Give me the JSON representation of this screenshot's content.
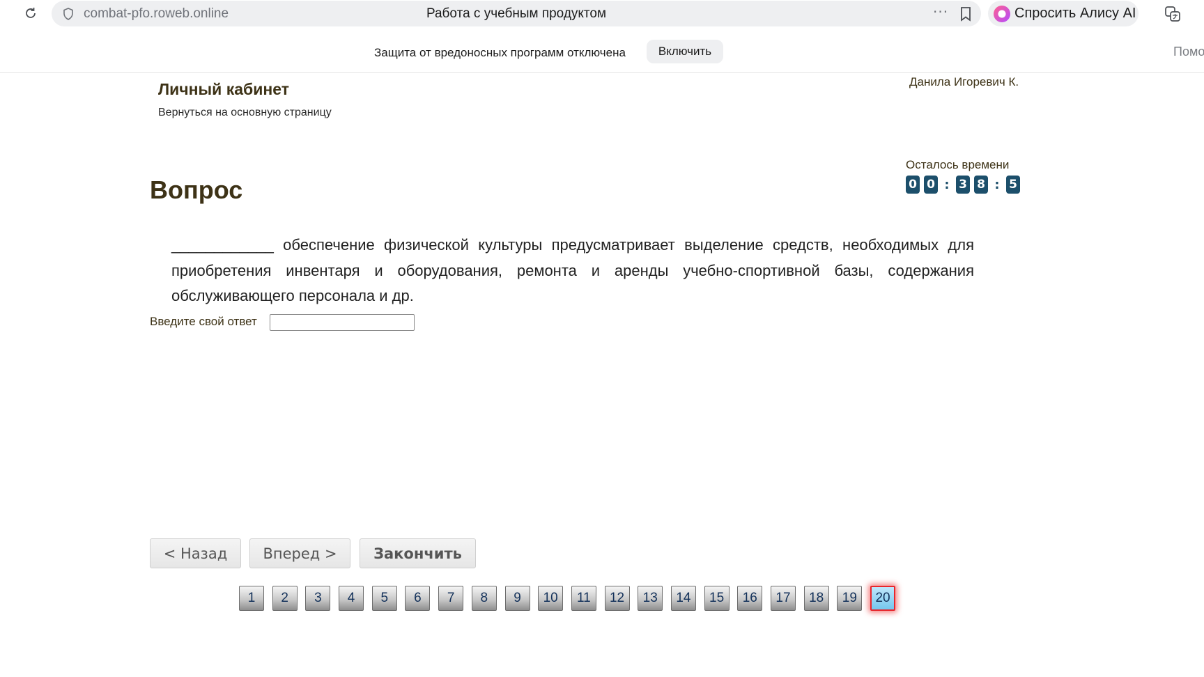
{
  "browser": {
    "url": "combat-pfo.roweb.online",
    "tab_title": "Работа с учебным продуктом",
    "more_glyph": "···",
    "alice_label": "Спросить Алису AI"
  },
  "infobar": {
    "message": "Защита от вредоносных программ отключена",
    "enable_button": "Включить",
    "help_text": "Помо"
  },
  "header": {
    "cabinet_title": "Личный кабинет",
    "back_link": "Вернуться на основную страницу",
    "user_name": "Данила Игоревич К."
  },
  "timer": {
    "label": "Осталось времени",
    "digits": [
      "0",
      "0",
      "3",
      "8",
      "5"
    ],
    "separator": ":"
  },
  "question": {
    "title": "Вопрос",
    "text": "____________ обеспечение физической культуры предусматривает выделение средств, необходимых для приобретения инвентаря и оборудования, ремонта и аренды учебно-спортивной базы, содержания обслуживающего персонала и др.",
    "answer_label": "Введите свой ответ",
    "answer_value": ""
  },
  "navigation": {
    "back": "< Назад",
    "next": "Вперед >",
    "finish": "Закончить"
  },
  "pager": {
    "pages": [
      "1",
      "2",
      "3",
      "4",
      "5",
      "6",
      "7",
      "8",
      "9",
      "10",
      "11",
      "12",
      "13",
      "14",
      "15",
      "16",
      "17",
      "18",
      "19",
      "20"
    ],
    "current": "20"
  },
  "colors": {
    "heading": "#3d3216",
    "timer_digit_bg": "#1c4f6b",
    "current_page_border": "#e8262c",
    "current_page_fill": "#74c6ee"
  }
}
